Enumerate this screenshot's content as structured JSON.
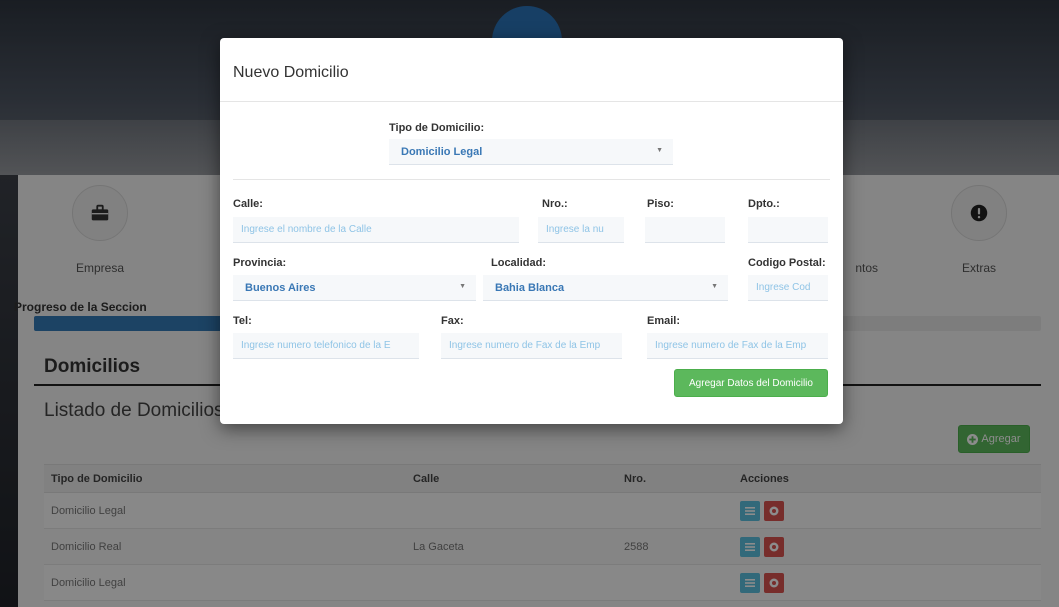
{
  "steps": [
    {
      "label": "Empresa",
      "icon": "briefcase-icon"
    },
    {
      "label": "ntos",
      "icon": "blank-icon"
    },
    {
      "label": "Extras",
      "icon": "exclamation-icon"
    }
  ],
  "progress": {
    "label": "Progreso de la Seccion",
    "fraction": 0.19
  },
  "panel": {
    "title": "Domicilios",
    "subtitle": "Listado de Domicilios C",
    "add_button": "Agregar"
  },
  "table": {
    "headers": [
      "Tipo de Domicilio",
      "Calle",
      "Nro.",
      "Acciones"
    ],
    "rows": [
      {
        "tipo": "Domicilio Legal",
        "calle": "",
        "nro": ""
      },
      {
        "tipo": "Domicilio Real",
        "calle": "La Gaceta",
        "nro": "2588"
      },
      {
        "tipo": "Domicilio Legal",
        "calle": "",
        "nro": ""
      }
    ]
  },
  "modal": {
    "title": "Nuevo Domicilio",
    "tipo_label": "Tipo de Domicilio:",
    "tipo_value": "Domicilio Legal",
    "calle_label": "Calle:",
    "calle_placeholder": "Ingrese el nombre de la Calle",
    "nro_label": "Nro.:",
    "nro_placeholder": "Ingrese la nu",
    "piso_label": "Piso:",
    "piso_placeholder": "",
    "dpto_label": "Dpto.:",
    "dpto_placeholder": "",
    "provincia_label": "Provincia:",
    "provincia_value": "Buenos Aires",
    "localidad_label": "Localidad:",
    "localidad_value": "Bahia Blanca",
    "cp_label": "Codigo Postal:",
    "cp_placeholder": "Ingrese Cod",
    "tel_label": "Tel:",
    "tel_placeholder": "Ingrese numero telefonico de la E",
    "fax_label": "Fax:",
    "fax_placeholder": "Ingrese numero de Fax de la Emp",
    "email_label": "Email:",
    "email_placeholder": "Ingrese numero de Fax de la Emp",
    "submit_label": "Agregar Datos del Domicilio"
  },
  "colors": {
    "primary": "#337ab7",
    "success": "#5cb85c",
    "info": "#5bc0de",
    "danger": "#d9534f"
  }
}
